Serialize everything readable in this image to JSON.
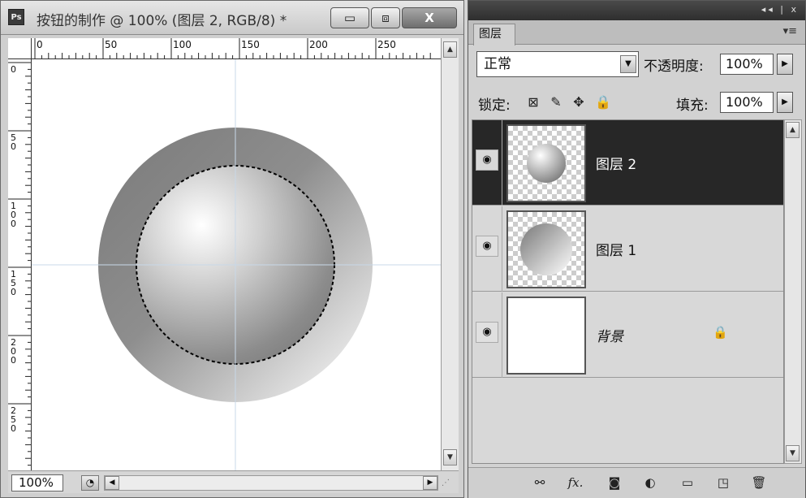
{
  "document": {
    "app_icon_label": "Ps",
    "title": "按钮的制作 @ 100% (图层 2, RGB/8) *",
    "window_buttons": {
      "minimize": "▭",
      "maximize": "⧈",
      "close": "X"
    },
    "ruler_top_labels": [
      "0",
      "50",
      "100",
      "150",
      "200",
      "250"
    ],
    "ruler_left_labels": [
      "0",
      "5\n0",
      "1\n0\n0",
      "1\n5\n0",
      "2\n0\n0",
      "2\n5\n0"
    ],
    "zoom": "100%",
    "scroll_up": "▲",
    "scroll_down": "▼",
    "scroll_left": "◀",
    "scroll_right": "▶"
  },
  "panel": {
    "collapse_icons": "◂◂ | x",
    "tab_label": "图层",
    "menu_icon": "▾≡",
    "blend_mode": "正常",
    "opacity_label": "不透明度:",
    "opacity_value": "100%",
    "lock_label": "锁定:",
    "fill_label": "填充:",
    "fill_value": "100%",
    "lock_icons": [
      "lock-transparent-icon",
      "brush-icon",
      "move-icon",
      "lock-icon"
    ],
    "layers": [
      {
        "name": "图层 2",
        "selected": true,
        "visible": true,
        "locked": false
      },
      {
        "name": "图层 1",
        "selected": false,
        "visible": true,
        "locked": false
      },
      {
        "name": "背景",
        "selected": false,
        "visible": true,
        "locked": true
      }
    ],
    "bottom_icons": [
      "link-icon",
      "fx-icon",
      "mask-icon",
      "adjustment-icon",
      "group-icon",
      "new-layer-icon",
      "trash-icon"
    ],
    "fx_label": "fx."
  }
}
